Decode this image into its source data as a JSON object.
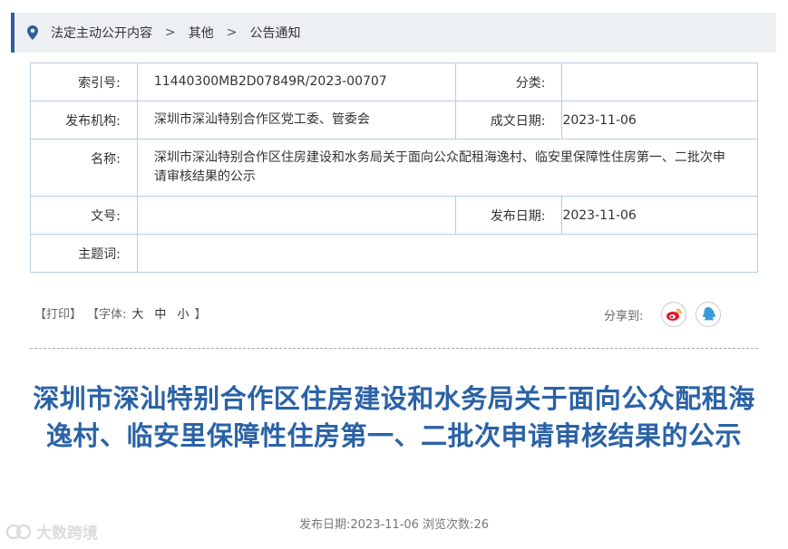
{
  "breadcrumb": {
    "items": [
      "法定主动公开内容",
      "其他",
      "公告通知"
    ],
    "separator": ">"
  },
  "meta": {
    "index_label": "索引号:",
    "index_value": "11440300MB2D07849R/2023-00707",
    "category_label": "分类:",
    "category_value": "",
    "publisher_label": "发布机构:",
    "publisher_value": "深圳市深汕特别合作区党工委、管委会",
    "created_label": "成文日期:",
    "created_value": "2023-11-06",
    "name_label": "名称:",
    "name_value": "深圳市深汕特别合作区住房建设和水务局关于面向公众配租海逸村、临安里保障性住房第一、二批次申请审核结果的公示",
    "docno_label": "文号:",
    "docno_value": "",
    "pubdate_label": "发布日期:",
    "pubdate_value": "2023-11-06",
    "keywords_label": "主题词:",
    "keywords_value": ""
  },
  "tools": {
    "print": "【打印】",
    "font_prefix": "【字体:",
    "font_large": "大",
    "font_medium": "中",
    "font_small": "小",
    "font_suffix": "】",
    "share_label": "分享到:",
    "share_icons": [
      "weibo-icon",
      "qq-icon"
    ]
  },
  "article": {
    "title": "深圳市深汕特别合作区住房建设和水务局关于面向公众配租海逸村、临安里保障性住房第一、二批次申请审核结果的公示",
    "publish_info": "发布日期:2023-11-06 浏览次数:26"
  },
  "watermark": {
    "text": "大数跨境"
  },
  "colors": {
    "accent": "#2f5f98",
    "title": "#2a62a6",
    "table_border": "#b9cde3",
    "breadcrumb_bg": "#edf0f3",
    "weibo": "#e6162d",
    "qq": "#3a9bd9"
  }
}
